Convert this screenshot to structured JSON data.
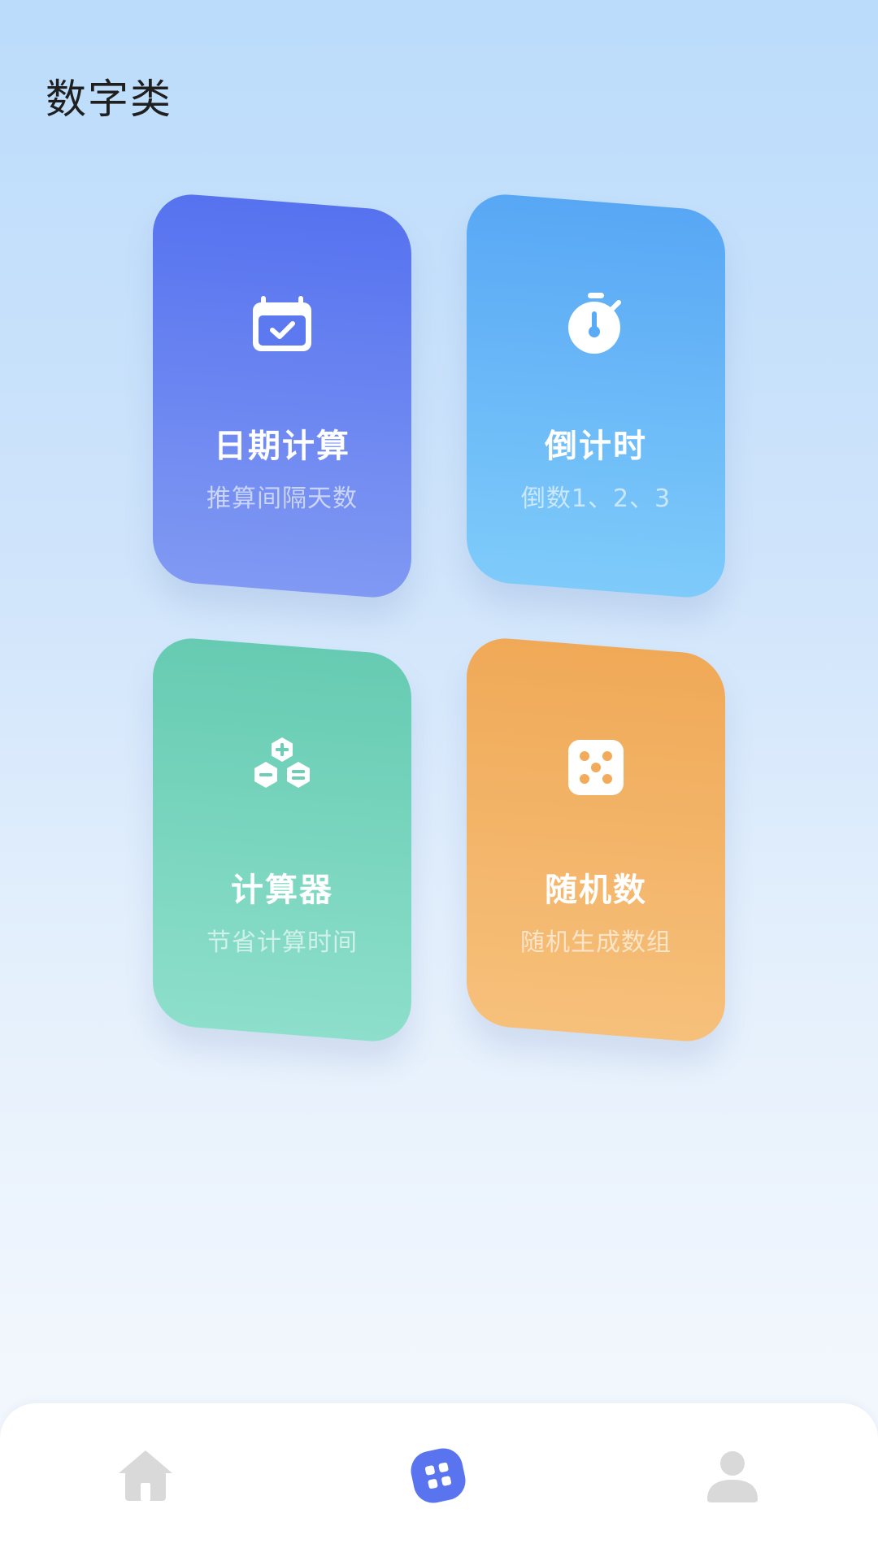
{
  "page": {
    "title": "数字类"
  },
  "cards": [
    {
      "id": "date",
      "title": "日期计算",
      "subtitle": "推算间隔天数",
      "icon": "calendar-check-icon",
      "color_top": "#5672ef",
      "color_bottom": "#8099f3"
    },
    {
      "id": "countdown",
      "title": "倒计时",
      "subtitle": "倒数1、2、3",
      "icon": "stopwatch-icon",
      "color_top": "#58a7f5",
      "color_bottom": "#7ecbfa"
    },
    {
      "id": "calculator",
      "title": "计算器",
      "subtitle": "节省计算时间",
      "icon": "calculator-hexagon-icon",
      "color_top": "#66cbb2",
      "color_bottom": "#8ddfcb"
    },
    {
      "id": "random",
      "title": "随机数",
      "subtitle": "随机生成数组",
      "icon": "dice-icon",
      "color_top": "#f0a957",
      "color_bottom": "#f6c07b"
    }
  ],
  "nav": {
    "items": [
      {
        "id": "home",
        "icon": "home-icon",
        "active": false
      },
      {
        "id": "tools",
        "icon": "tools-grid-icon",
        "active": true
      },
      {
        "id": "profile",
        "icon": "profile-icon",
        "active": false
      }
    ],
    "active_color": "#5a74ef",
    "inactive_color": "#d9d9d9"
  }
}
